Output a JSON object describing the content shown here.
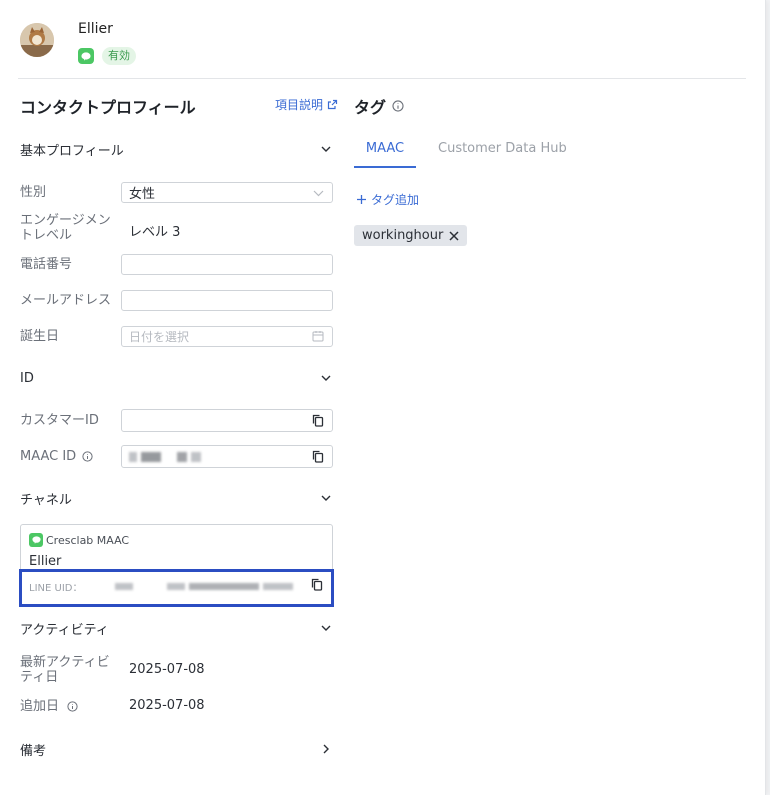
{
  "header": {
    "user_name": "Ellier",
    "status": "有効"
  },
  "profile": {
    "title": "コンタクトプロフィール",
    "help_link": "項目説明",
    "basic_group": "基本プロフィール",
    "fields": {
      "gender_label": "性別",
      "gender_value": "女性",
      "engagement_label_1": "エンゲージメン",
      "engagement_label_2": "トレベル",
      "engagement_value": "レベル 3",
      "phone_label": "電話番号",
      "email_label": "メールアドレス",
      "birthday_label": "誕生日",
      "birthday_placeholder": "日付を選択"
    },
    "id_group": "ID",
    "id_fields": {
      "customer_id_label": "カスタマーID",
      "maac_id_label": "MAAC ID"
    },
    "channel_group": "チャネル",
    "channel": {
      "source": "Cresclab MAAC",
      "name": "Ellier",
      "uid_label": "LINE UID："
    },
    "activity_group": "アクティビティ",
    "activity": {
      "latest_label_1": "最新アクティビ",
      "latest_label_2": "ティ日",
      "latest_value": "2025-07-08",
      "added_label": "追加日",
      "added_value": "2025-07-08"
    },
    "notes_group": "備考"
  },
  "tags": {
    "title": "タグ",
    "tabs": [
      "MAAC",
      "Customer Data Hub"
    ],
    "active_tab": "MAAC",
    "add_label": "タグ追加",
    "items": [
      "workinghour"
    ]
  },
  "colors": {
    "accent": "#3a6bd4",
    "highlight_border": "#2b4dc2",
    "line_green": "#4cc764"
  }
}
